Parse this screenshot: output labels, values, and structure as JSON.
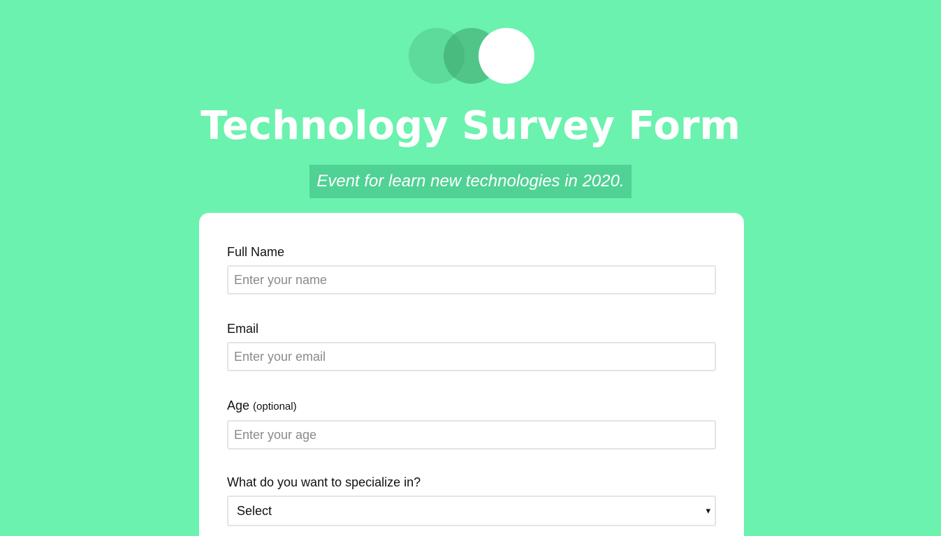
{
  "header": {
    "title": "Technology Survey Form",
    "description": "Event for learn new technologies in 2020."
  },
  "form": {
    "name": {
      "label": "Full Name",
      "placeholder": "Enter your name"
    },
    "email": {
      "label": "Email",
      "placeholder": "Enter your email"
    },
    "age": {
      "label": "Age",
      "label_note": "(optional)",
      "placeholder": "Enter your age"
    },
    "specialize": {
      "label": "What do you want to specialize in?",
      "selected": "Select",
      "chevron_icon": "▾"
    }
  },
  "colors": {
    "background": "#6af2ae",
    "card": "#ffffff",
    "subtitle_bg": "#4fd294"
  },
  "icons": {
    "logo": "logo-circles-icon"
  }
}
